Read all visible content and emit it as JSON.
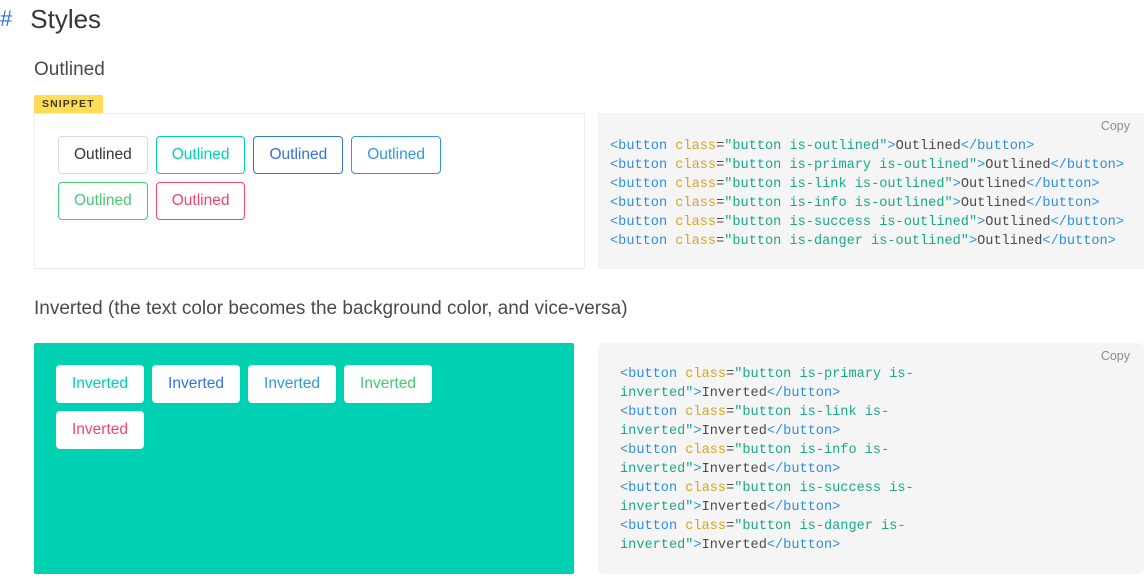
{
  "heading": {
    "anchor": "#",
    "title": "Styles"
  },
  "sections": [
    {
      "id": "outlined",
      "subheading": "Outlined",
      "badge": "SNIPPET",
      "copy_label": "Copy",
      "buttons_row1": [
        {
          "label": "Outlined",
          "variant": "is-outlined",
          "color_class": "default",
          "color": "#dbdbdb"
        },
        {
          "label": "Outlined",
          "variant": "is-outlined",
          "color_class": "primary",
          "color": "#00d1b2"
        },
        {
          "label": "Outlined",
          "variant": "is-outlined",
          "color_class": "link",
          "color": "#3273dc"
        },
        {
          "label": "Outlined",
          "variant": "is-outlined",
          "color_class": "info",
          "color": "#3298dc"
        }
      ],
      "buttons_row2": [
        {
          "label": "Outlined",
          "variant": "is-outlined",
          "color_class": "success",
          "color": "#48c774"
        },
        {
          "label": "Outlined",
          "variant": "is-outlined",
          "color_class": "danger",
          "color": "#f14668"
        }
      ],
      "code_lines": [
        {
          "tag_open": "<button ",
          "attr": "class",
          "eq": "=",
          "q1": "\"",
          "val": "button is-outlined",
          "q2": "\"",
          "gt": ">",
          "text": "Outlined",
          "tag_close": "</button>"
        },
        {
          "tag_open": "<button ",
          "attr": "class",
          "eq": "=",
          "q1": "\"",
          "val": "button is-primary is-outlined",
          "q2": "\"",
          "gt": ">",
          "text": "Outlined",
          "tag_close": "</button>"
        },
        {
          "tag_open": "<button ",
          "attr": "class",
          "eq": "=",
          "q1": "\"",
          "val": "button is-link is-outlined",
          "q2": "\"",
          "gt": ">",
          "text": "Outlined",
          "tag_close": "</button>"
        },
        {
          "tag_open": "<button ",
          "attr": "class",
          "eq": "=",
          "q1": "\"",
          "val": "button is-info is-outlined",
          "q2": "\"",
          "gt": ">",
          "text": "Outlined",
          "tag_close": "</button>"
        },
        {
          "tag_open": "<button ",
          "attr": "class",
          "eq": "=",
          "q1": "\"",
          "val": "button is-success is-outlined",
          "q2": "\"",
          "gt": ">",
          "text": "Outlined",
          "tag_close": "</button>"
        },
        {
          "tag_open": "<button ",
          "attr": "class",
          "eq": "=",
          "q1": "\"",
          "val": "button is-danger is-outlined",
          "q2": "\"",
          "gt": ">",
          "text": "Outlined",
          "tag_close": "</button>"
        }
      ]
    },
    {
      "id": "inverted",
      "subheading": "Inverted (the text color becomes the background color, and vice-versa)",
      "copy_label": "Copy",
      "panel_bg": "#00d1b2",
      "buttons_row1": [
        {
          "label": "Inverted",
          "variant": "is-inverted",
          "color_class": "primary",
          "color": "#00d1b2"
        },
        {
          "label": "Inverted",
          "variant": "is-inverted",
          "color_class": "link",
          "color": "#3273dc"
        },
        {
          "label": "Inverted",
          "variant": "is-inverted",
          "color_class": "info",
          "color": "#3298dc"
        },
        {
          "label": "Inverted",
          "variant": "is-inverted",
          "color_class": "success",
          "color": "#48c774"
        }
      ],
      "buttons_row2": [
        {
          "label": "Inverted",
          "variant": "is-inverted",
          "color_class": "danger",
          "color": "#f14668"
        }
      ],
      "code_lines": [
        {
          "tag_open": "<button ",
          "attr": "class",
          "eq": "=",
          "q1": "\"",
          "val": "button is-primary is-inverted",
          "q2": "\"",
          "gt": ">",
          "text": "Inverted",
          "tag_close": "</button>"
        },
        {
          "tag_open": "<button ",
          "attr": "class",
          "eq": "=",
          "q1": "\"",
          "val": "button is-link is-inverted",
          "q2": "\"",
          "gt": ">",
          "text": "Inverted",
          "tag_close": "</button>"
        },
        {
          "tag_open": "<button ",
          "attr": "class",
          "eq": "=",
          "q1": "\"",
          "val": "button is-info is-inverted",
          "q2": "\"",
          "gt": ">",
          "text": "Inverted",
          "tag_close": "</button>"
        },
        {
          "tag_open": "<button ",
          "attr": "class",
          "eq": "=",
          "q1": "\"",
          "val": "button is-success is-inverted",
          "q2": "\"",
          "gt": ">",
          "text": "Inverted",
          "tag_close": "</button>"
        },
        {
          "tag_open": "<button ",
          "attr": "class",
          "eq": "=",
          "q1": "\"",
          "val": "button is-danger is-inverted",
          "q2": "\"",
          "gt": ">",
          "text": "Inverted",
          "tag_close": "</button>"
        }
      ]
    }
  ]
}
